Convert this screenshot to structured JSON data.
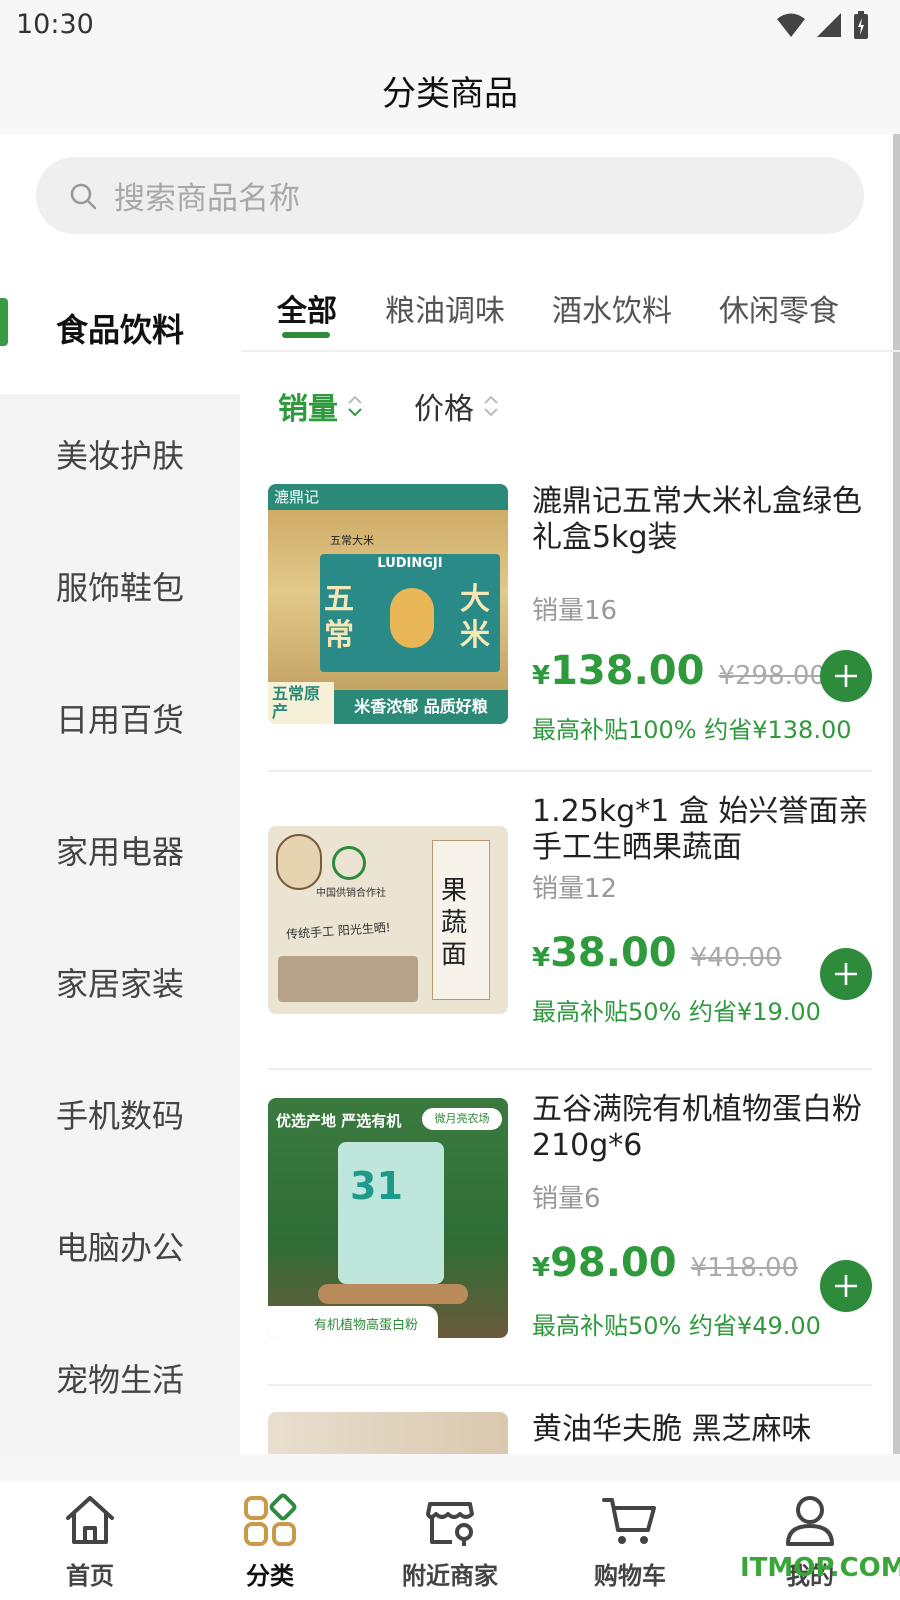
{
  "status_bar": {
    "time": "10:30"
  },
  "header": {
    "title": "分类商品"
  },
  "search": {
    "placeholder": "搜索商品名称"
  },
  "sidebar": {
    "items": [
      {
        "label": "食品饮料"
      },
      {
        "label": "美妆护肤"
      },
      {
        "label": "服饰鞋包"
      },
      {
        "label": "日用百货"
      },
      {
        "label": "家用电器"
      },
      {
        "label": "家居家装"
      },
      {
        "label": "手机数码"
      },
      {
        "label": "电脑办公"
      },
      {
        "label": "宠物生活"
      }
    ]
  },
  "tabs": [
    {
      "label": "全部"
    },
    {
      "label": "粮油调味"
    },
    {
      "label": "酒水饮料"
    },
    {
      "label": "休闲零食"
    }
  ],
  "sort": {
    "sales": "销量",
    "price": "价格"
  },
  "products": [
    {
      "name": "漉鼎记五常大米礼盒绿色礼盒5kg装",
      "sales": "销量16",
      "currency": "¥",
      "price": "138.00",
      "original_price": "¥298.00",
      "subsidy": "最高补贴100% 约省¥138.00",
      "image": {
        "brand": "漉鼎记",
        "brand_en": "LUDINGJI",
        "tag": "五常大米",
        "left_chars": "五常",
        "right_chars": "大米",
        "corner": "五常原产",
        "slogan": "米香浓郁 品质好粮"
      }
    },
    {
      "name": "1.25kg*1 盒 始兴誉面亲手工生晒果蔬面",
      "sales": "销量12",
      "currency": "¥",
      "price": "38.00",
      "original_price": "¥40.00",
      "subsidy": "最高补贴50% 约省¥19.00",
      "image": {
        "title": "果蔬面",
        "coop": "中国供销合作社",
        "handwriting": "传统手工 阳光生晒!"
      }
    },
    {
      "name": "五谷满院有机植物蛋白粉210g*6",
      "sales": "销量6",
      "currency": "¥",
      "price": "98.00",
      "original_price": "¥118.00",
      "subsidy": "最高补贴50% 约省¥49.00",
      "image": {
        "top": "优选产地 严选有机",
        "badge": "微月亮农场",
        "number": "31",
        "bottom": "有机植物高蛋白粉"
      }
    },
    {
      "name": "黄油华夫脆 黑芝麻味"
    }
  ],
  "tabbar": [
    {
      "label": "首页",
      "icon": "home-icon"
    },
    {
      "label": "分类",
      "icon": "category-icon"
    },
    {
      "label": "附近商家",
      "icon": "nearby-store-icon"
    },
    {
      "label": "购物车",
      "icon": "cart-icon"
    },
    {
      "label": "我的",
      "icon": "profile-icon"
    }
  ],
  "watermark": "ITMOP.COM",
  "colors": {
    "accent": "#2e8b3b",
    "price": "#2e9a3c"
  }
}
